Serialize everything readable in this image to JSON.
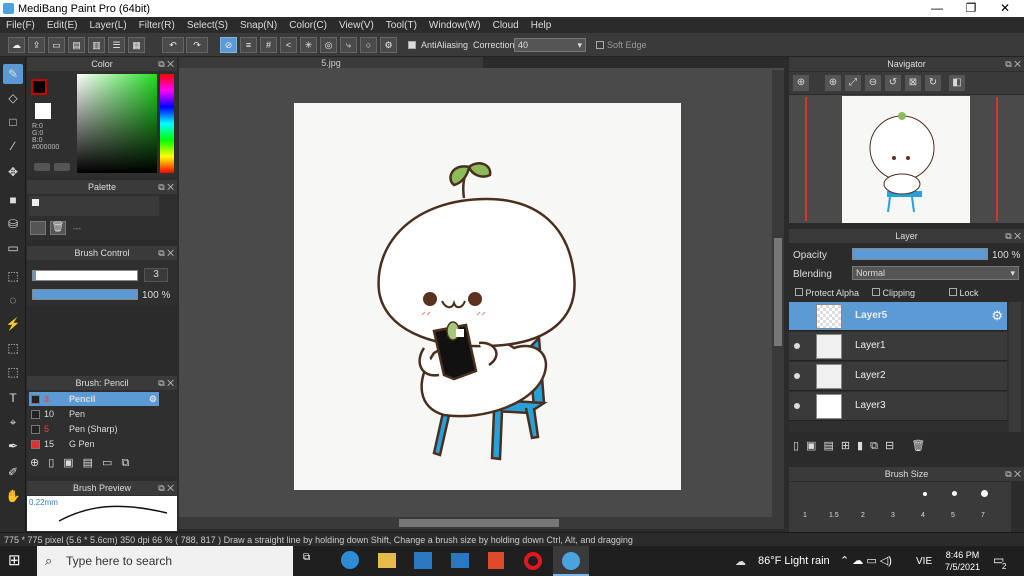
{
  "window": {
    "title": "MediBang Paint Pro (64bit)"
  },
  "menu": [
    "File(F)",
    "Edit(E)",
    "Layer(L)",
    "Filter(R)",
    "Select(S)",
    "Snap(N)",
    "Color(C)",
    "View(V)",
    "Tool(T)",
    "Window(W)",
    "Cloud",
    "Help"
  ],
  "toolbar": {
    "antialiasing_label": "AntiAliasing",
    "correction_label": "Correction",
    "correction_value": "40",
    "soft_edge_label": "Soft Edge"
  },
  "document": {
    "tab": "5.jpg"
  },
  "color_panel": {
    "title": "Color",
    "r": "R:0",
    "g": "G:0",
    "b": "B:0",
    "hex": "#000000"
  },
  "palette_panel": {
    "title": "Palette",
    "placeholder": "---"
  },
  "brush_control": {
    "title": "Brush Control",
    "size": "3",
    "opacity": "100 %"
  },
  "brush_panel": {
    "title": "Brush: Pencil",
    "items": [
      {
        "size": "3",
        "name": "Pencil",
        "color": "#222222"
      },
      {
        "size": "10",
        "name": "Pen",
        "color": "#222222"
      },
      {
        "size": "5",
        "name": "Pen (Sharp)",
        "color": "#222222"
      },
      {
        "size": "15",
        "name": "G Pen",
        "color": "#e03030"
      }
    ]
  },
  "brush_preview": {
    "title": "Brush Preview",
    "size": "0.22mm"
  },
  "navigator": {
    "title": "Navigator"
  },
  "layer_panel": {
    "title": "Layer",
    "opacity_label": "Opacity",
    "opacity_value": "100 %",
    "blending_label": "Blending",
    "blending_value": "Normal",
    "protect_alpha": "Protect Alpha",
    "clipping": "Clipping",
    "lock": "Lock",
    "layers": [
      "Layer5",
      "Layer1",
      "Layer2",
      "Layer3"
    ]
  },
  "brush_size_panel": {
    "title": "Brush Size",
    "sizes": [
      "1",
      "1.5",
      "2",
      "3",
      "4",
      "5",
      "7"
    ]
  },
  "status": {
    "text": "775 * 775 pixel   (5.6 * 5.6cm)   350 dpi   66 %   ( 788, 817 )   Draw a straight line by holding down Shift, Change a brush size by holding down Ctrl, Alt, and dragging"
  },
  "taskbar": {
    "search_placeholder": "Type here to search",
    "weather": "86°F  Light rain",
    "lang": "VIE",
    "time": "8:46 PM",
    "date": "7/5/2021",
    "notifications": "2"
  },
  "colors": {
    "accent": "#5c9ad6",
    "chair": "#2aa0d8",
    "leaf": "#8dbb5a"
  }
}
